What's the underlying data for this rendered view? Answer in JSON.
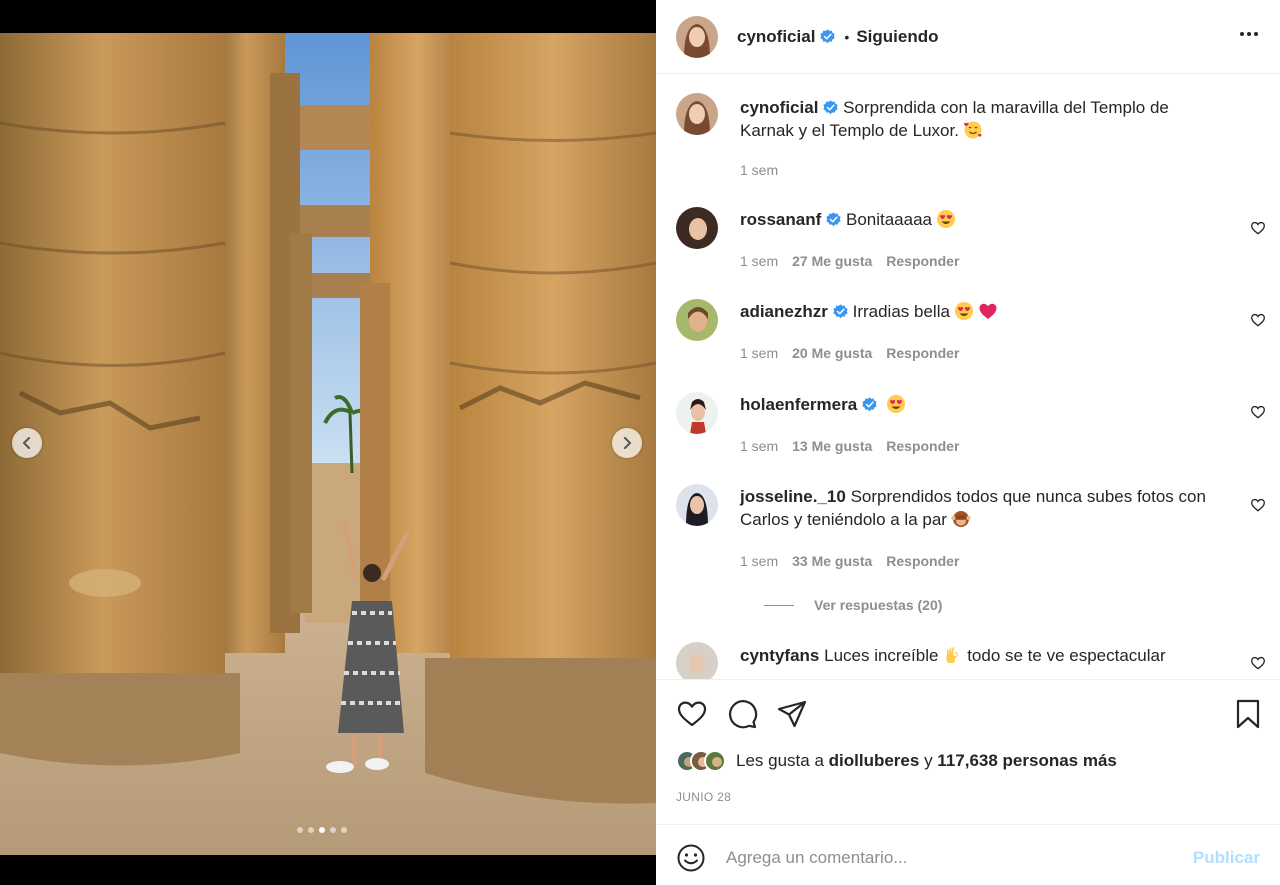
{
  "post": {
    "author": "cynoficial",
    "separator": "•",
    "follow_status": "Siguiendo",
    "caption_text": "Sorprendida con la maravilla del Templo de Karnak y el Templo de Luxor.",
    "caption_time": "1 sem",
    "carousel": {
      "total": 5,
      "active_index": 2
    }
  },
  "comments": [
    {
      "user": "rossananf",
      "verified": true,
      "text": "Bonitaaaaa",
      "emoji": [
        "heart-eyes"
      ],
      "time": "1 sem",
      "likes": "27 Me gusta",
      "reply": "Responder"
    },
    {
      "user": "adianezhzr",
      "verified": true,
      "text": "Irradias bella",
      "emoji": [
        "heart-eyes",
        "red-heart"
      ],
      "time": "1 sem",
      "likes": "20 Me gusta",
      "reply": "Responder"
    },
    {
      "user": "holaenfermera",
      "verified": true,
      "text": "",
      "emoji": [
        "heart-eyes"
      ],
      "time": "1 sem",
      "likes": "13 Me gusta",
      "reply": "Responder"
    },
    {
      "user": "josseline._10",
      "verified": false,
      "text": "Sorprendidos todos que nunca subes fotos con Carlos y teniéndolo a la par",
      "emoji": [
        "see-no-evil-monkey"
      ],
      "time": "1 sem",
      "likes": "33 Me gusta",
      "reply": "Responder",
      "view_replies": "Ver respuestas (20)"
    },
    {
      "user": "cyntyfans",
      "verified": false,
      "text_part1": "Luces increíble",
      "text_part2": "todo se te ve espectacular",
      "emoji": [
        "ok-hand"
      ]
    }
  ],
  "likes": {
    "prefix": "Les gusta a",
    "first_user": "diolluberes",
    "conjunction": "y",
    "others": "117,638 personas más"
  },
  "date": "JUNIO 28",
  "add_comment": {
    "placeholder": "Agrega un comentario...",
    "publish_label": "Publicar"
  },
  "icons": {
    "like": "heart-icon",
    "comment": "comment-icon",
    "share": "share-icon",
    "save": "bookmark-icon",
    "more": "more-options-icon",
    "emoji": "emoji-icon"
  },
  "colors": {
    "verified": "#3897f0",
    "muted_text": "#8e8e8e",
    "publish_disabled": "#b2dffc"
  }
}
